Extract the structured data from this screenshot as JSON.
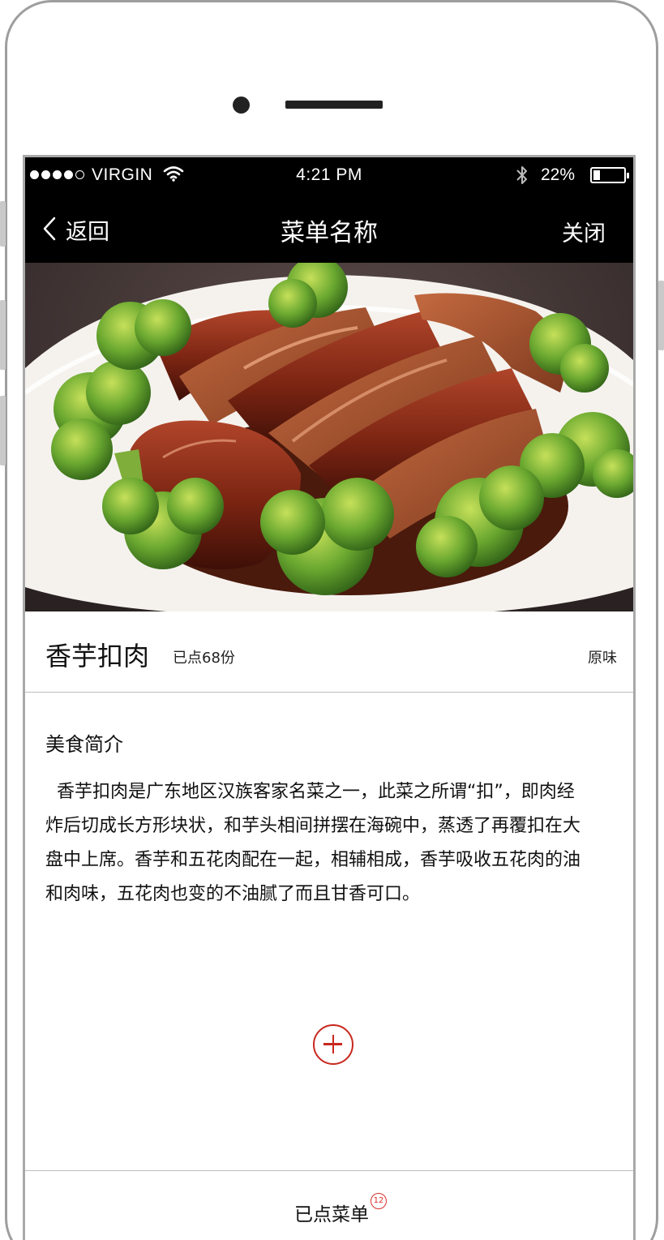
{
  "status_bar": {
    "signal_dots_filled": 4,
    "signal_dots_total": 5,
    "carrier": "VIRGIN",
    "time": "4:21 PM",
    "battery_percent_text": "22%",
    "battery_level": 0.22,
    "icons": [
      "signal-dots-icon",
      "wifi-icon",
      "bluetooth-icon",
      "battery-icon"
    ]
  },
  "nav": {
    "back_label": "返回",
    "title": "菜单名称",
    "close_label": "关闭",
    "icons": [
      "chevron-left-icon"
    ]
  },
  "dish": {
    "name": "香芋扣肉",
    "order_count": "已点68份",
    "flavor": "原味"
  },
  "intro": {
    "heading": "美食简介",
    "text": "香芋扣肉是广东地区汉族客家名菜之一，此菜之所谓“扣”，即肉经炸后切成长方形块状，和芋头相间拼摆在海碗中，蒸透了再覆扣在大盘中上席。香芋和五花肉配在一起，相辅相成，香芋吸收五花肉的油和肉味，五花肉也变的不油腻了而且甘香可口。"
  },
  "actions": {
    "add_icon": "plus-circle-icon"
  },
  "bottom_bar": {
    "ordered_label": "已点菜单",
    "ordered_badge": "12"
  },
  "colors": {
    "bar_background": "#000000",
    "accent_red": "#c8281e",
    "divider": "#bdbdbd"
  }
}
